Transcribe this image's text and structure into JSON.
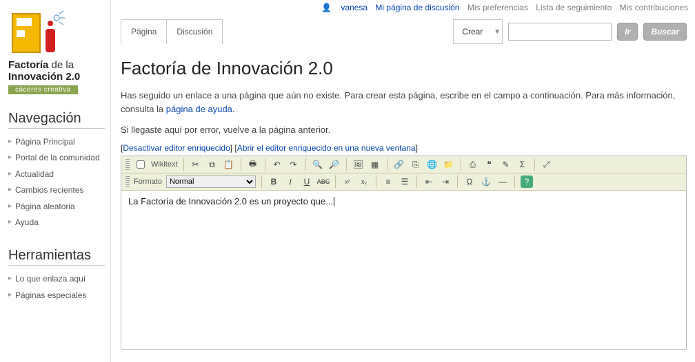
{
  "top_links": {
    "user": "vanesa",
    "talk": "Mi página de discusión",
    "prefs": "Mis preferencias",
    "watch": "Lista de seguimiento",
    "contrib": "Mis contribuciones"
  },
  "logo": {
    "line1_bold": "Factoría",
    "line1_rest": " de la",
    "line2_bold": "Innovación 2.0",
    "badge": "cáceres creativa"
  },
  "sidebar": {
    "nav_title": "Navegación",
    "nav_items": [
      "Página Principal",
      "Portal de la comunidad",
      "Actualidad",
      "Cambios recientes",
      "Página aleatoria",
      "Ayuda"
    ],
    "tools_title": "Herramientas",
    "tools_items": [
      "Lo que enlaza aquí",
      "Páginas especiales"
    ]
  },
  "tabs": {
    "page": "Página",
    "talk": "Discusión"
  },
  "crear": {
    "label": "Crear"
  },
  "search": {
    "go": "Ir",
    "search": "Buscar",
    "value": ""
  },
  "page": {
    "title": "Factoría de Innovación 2.0",
    "intro_before": "Has seguido un enlace a una página que aún no existe. Para crear esta página, escribe en el campo a continuación. Para más información, consulta la ",
    "intro_link": "página de ayuda",
    "intro_after": ".",
    "error_line": "Si llegaste aquí por error, vuelve a la página anterior.",
    "link_disable": "Desactivar editor enriquecido",
    "link_newwin": "Abrir el editor enriquecido en una nueva ventana"
  },
  "editor": {
    "wikitext": "Wikitext",
    "formato": "Formato",
    "format_value": "Normal",
    "content": "La Factoría de Innovación 2.0 es un proyecto que..."
  }
}
